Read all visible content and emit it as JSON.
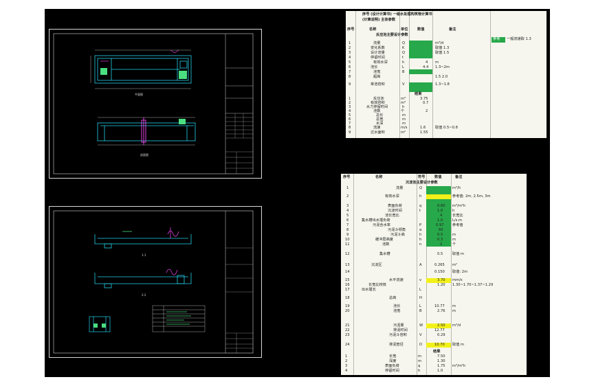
{
  "colors": {
    "canvas": "#000000",
    "sheet_border": "#d8d8d8",
    "cad_cyan": "#22d3ee",
    "cad_magenta": "#e040e0",
    "cad_green": "#4ade80",
    "cell_green": "#27a84a",
    "cell_yellow": "#f2f01a"
  },
  "drawings": {
    "top_plan_title": "平面图",
    "top_section_title": "剖面图",
    "bottom_section1_title": "1-1",
    "bottom_section2_title": "2-2"
  },
  "sheet1": {
    "title_line1": "序号 (设计计算书) 一级水处理构筑物计算书",
    "title_line2": "(计算说明) 主体参数",
    "headers": [
      "序号",
      "名称",
      "单位",
      "数值",
      "备注"
    ],
    "section1": "反应池主要设计参数",
    "rows": [
      {
        "n": "1",
        "name": "流量",
        "unit": "Q",
        "val": "",
        "note": "m³/d"
      },
      {
        "n": "2",
        "name": "变化系数",
        "unit": "K",
        "val": "",
        "note": "取值 1.3"
      },
      {
        "n": "3",
        "name": "设计流量",
        "unit": "Q",
        "val": "",
        "note": "取值 1.5"
      },
      {
        "n": "4",
        "name": "停留时间",
        "unit": "t",
        "val": "",
        "note": ""
      },
      {
        "n": "5",
        "name": "有效水深",
        "unit": "h",
        "val": "4",
        "note": "m"
      },
      {
        "n": "6",
        "name": "池长",
        "unit": "L",
        "val": "4.4",
        "note": "1.3~2m"
      },
      {
        "n": "7",
        "name": "池宽",
        "unit": "B",
        "val": "",
        "note": ""
      },
      {
        "n": "8",
        "name": "超高",
        "unit": "",
        "val": "",
        "note": "1.5 2.0"
      },
      {
        "n": "9",
        "name": "单池容积",
        "unit": "V",
        "val": "",
        "note": "1.3~1.8"
      }
    ],
    "section2": "结果",
    "rows2": [
      {
        "n": "1",
        "name": "反应池",
        "unit": "m³",
        "val": "3.75",
        "note": ""
      },
      {
        "n": "2",
        "name": "有效容积",
        "unit": "m³",
        "val": "0.7",
        "note": ""
      },
      {
        "n": "3",
        "name": "水力停留时间",
        "unit": "h",
        "val": "",
        "note": ""
      },
      {
        "n": "4",
        "name": "池数",
        "unit": "个",
        "val": "2",
        "note": ""
      },
      {
        "n": "5",
        "name": "总长",
        "unit": "m",
        "val": "",
        "note": ""
      },
      {
        "n": "6",
        "name": "总宽",
        "unit": "m",
        "val": "",
        "note": ""
      },
      {
        "n": "7",
        "name": "水深",
        "unit": "m",
        "val": "",
        "note": ""
      },
      {
        "n": "8",
        "name": "流速",
        "unit": "m/s",
        "val": "1.6",
        "note": "取值 0.5~0.8"
      },
      {
        "n": "9",
        "name": "过水面积",
        "unit": "m²",
        "val": "1.55",
        "note": ""
      }
    ],
    "side_label": "参考",
    "side_note": "一般流速取 1.3"
  },
  "sheet2": {
    "headers": [
      "序号",
      "名称",
      "符号",
      "数值",
      "备注"
    ],
    "section1": "沉淀池主要设计参数",
    "rows": [
      {
        "n": "1",
        "name": "流量",
        "unit": "Q",
        "val": "",
        "note": "m³/h"
      },
      {
        "n": "2",
        "name": "有效水深",
        "unit": "h",
        "val": "",
        "note": "参考值: 2m, 2.5m, 3m"
      },
      {
        "n": "3",
        "name": "表面负荷",
        "unit": "q",
        "val": "0.60",
        "note": "m³/m²h"
      },
      {
        "n": "4",
        "name": "沉淀时间",
        "unit": "t",
        "val": "1.0",
        "note": "h"
      },
      {
        "n": "5",
        "name": "池长宽比",
        "unit": "",
        "val": "4",
        "note": "长宽比"
      },
      {
        "n": "6",
        "name": "集水槽出水堰负荷",
        "unit": "",
        "val": "1.0",
        "note": "L/s.m"
      },
      {
        "n": "7",
        "name": "污泥含水率",
        "unit": "P",
        "val": "0.97",
        "note": "参考值"
      },
      {
        "n": "8",
        "name": "污泥斗倾角",
        "unit": "α",
        "val": "60",
        "note": ""
      },
      {
        "n": "9",
        "name": "污泥斗高",
        "unit": "h",
        "val": "0.5",
        "note": "m"
      },
      {
        "n": "10",
        "name": "缓冲层高度",
        "unit": "h",
        "val": "0.3",
        "note": "m"
      },
      {
        "n": "11",
        "name": "池数",
        "unit": "n",
        "val": "2",
        "note": "个"
      },
      {
        "n": "12",
        "name": "集水槽",
        "unit": "",
        "val": "0.5",
        "note": "取值 m"
      }
    ],
    "rows_lower": [
      {
        "n": "13",
        "name": "沉淀区",
        "unit": "A",
        "val": "0.265",
        "note": "m²"
      },
      {
        "n": "14",
        "name": "",
        "unit": "",
        "val": "0.150",
        "note": "取值: 2m"
      },
      {
        "n": "15",
        "name": "水平流速",
        "unit": "v",
        "val": "3.70",
        "note": "mm/s"
      },
      {
        "n": "16",
        "name": "长宽比校核",
        "unit": "",
        "val": "1.20",
        "note": "1.30~1.70~1.37~1.29"
      },
      {
        "n": "17",
        "name": "出水堰长",
        "unit": "L",
        "val": "",
        "note": ""
      },
      {
        "n": "18",
        "name": "总高",
        "unit": "H",
        "val": "",
        "note": ""
      },
      {
        "n": "19",
        "name": "池长",
        "unit": "L",
        "val": "10.77",
        "note": "m"
      },
      {
        "n": "20",
        "name": "池宽",
        "unit": "B",
        "val": "2.76",
        "note": "m"
      },
      {
        "n": "21",
        "name": "污泥量",
        "unit": "W",
        "val": "2.50",
        "note": "m³/d"
      },
      {
        "n": "22",
        "name": "排泥时间",
        "unit": "",
        "val": "12.77",
        "note": ""
      },
      {
        "n": "23",
        "name": "污泥斗容积",
        "unit": "V",
        "val": "0.29",
        "note": ""
      },
      {
        "n": "24",
        "name": "排泥管径",
        "unit": "D",
        "val": "10.70",
        "note": "取值 m"
      }
    ],
    "section2": "结果",
    "rows2": [
      {
        "n": "1",
        "name": "长宽",
        "unit": "m",
        "val": "7.50",
        "note": ""
      },
      {
        "n": "2",
        "name": "深度",
        "unit": "m",
        "val": "1.30",
        "note": ""
      },
      {
        "n": "3",
        "name": "表面负荷",
        "unit": "q",
        "val": "1.75",
        "note": "m³/m²h"
      },
      {
        "n": "4",
        "name": "停留时间",
        "unit": "h",
        "val": "1.0",
        "note": ""
      },
      {
        "n": "5",
        "name": "水平流速",
        "unit": "v",
        "val": "2.50",
        "note": ""
      }
    ]
  }
}
